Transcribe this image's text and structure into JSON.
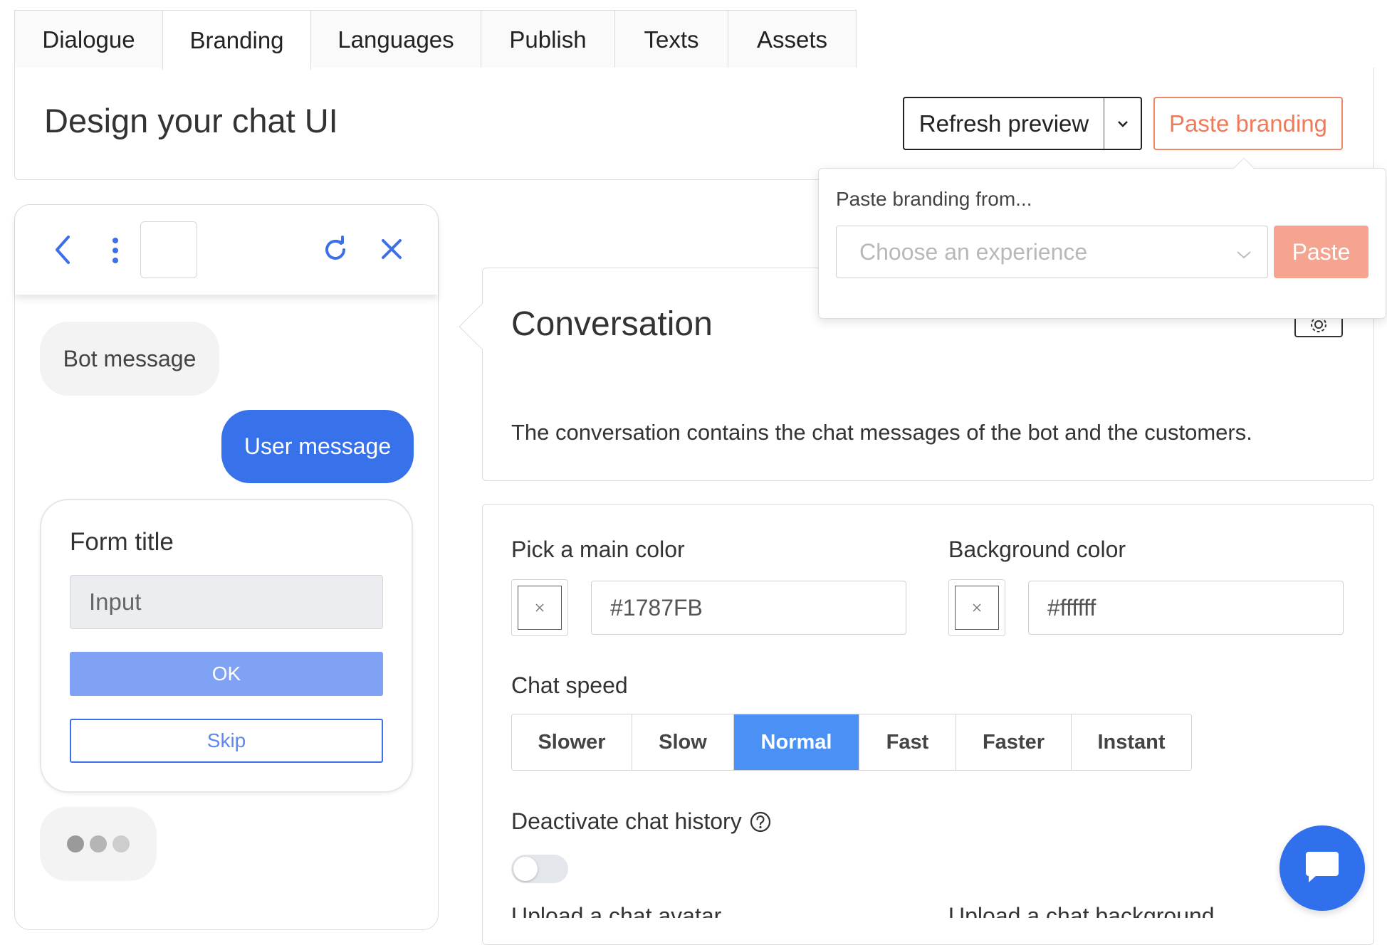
{
  "tabs": [
    {
      "label": "Dialogue"
    },
    {
      "label": "Branding",
      "active": true
    },
    {
      "label": "Languages"
    },
    {
      "label": "Publish"
    },
    {
      "label": "Texts"
    },
    {
      "label": "Assets"
    }
  ],
  "header": {
    "title": "Design your chat UI",
    "refresh_label": "Refresh preview",
    "paste_branding_label": "Paste branding"
  },
  "popover": {
    "label": "Paste branding from...",
    "select_placeholder": "Choose an experience",
    "paste_label": "Paste"
  },
  "chat_preview": {
    "bot_message": "Bot message",
    "user_message": "User message",
    "form": {
      "title": "Form title",
      "input_placeholder": "Input",
      "ok_label": "OK",
      "skip_label": "Skip"
    }
  },
  "conversation": {
    "title": "Conversation",
    "description": "The conversation contains the chat messages of the bot and the customers."
  },
  "settings": {
    "main_color_label": "Pick a main color",
    "main_color_value": "#1787FB",
    "background_color_label": "Background color",
    "background_color_value": "#ffffff",
    "chat_speed_label": "Chat speed",
    "speed_options": [
      "Slower",
      "Slow",
      "Normal",
      "Fast",
      "Faster",
      "Instant"
    ],
    "speed_selected": "Normal",
    "deactivate_history_label": "Deactivate chat history",
    "deactivate_history_on": false,
    "next_row_left_label": "Upload a chat avatar",
    "next_row_right_label": "Upload a chat background"
  },
  "colors": {
    "accent_blue": "#3872ea",
    "paste_orange": "#f07a5a",
    "speed_active": "#4a90f5"
  },
  "icons": [
    "back-arrow-icon",
    "more-vertical-icon",
    "refresh-icon",
    "close-icon",
    "chevron-down-icon",
    "settings-gear-icon",
    "help-circle-icon",
    "chat-bubble-icon"
  ]
}
